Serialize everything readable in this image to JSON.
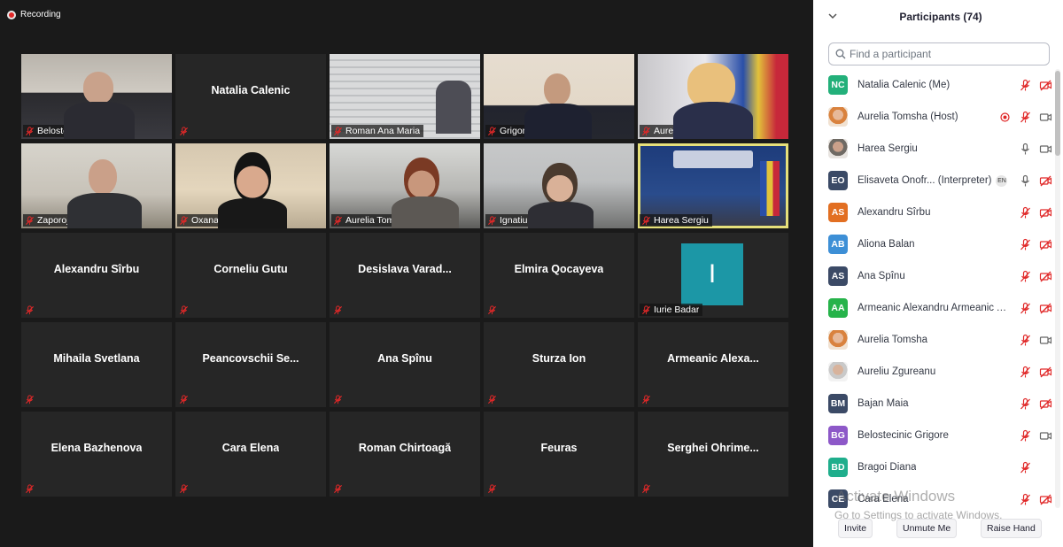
{
  "recording": {
    "label": "Recording"
  },
  "colors": {
    "panel_bg": "#ffffff",
    "muted_red": "#e02828",
    "active_speaker": "#e6e07a",
    "avatar_teal": "#1c97a6"
  },
  "tiles": [
    {
      "label": "Belostecinic Grig...",
      "video": "office"
    },
    {
      "center": "Natalia Calenic"
    },
    {
      "label": "Roman Ana Maria",
      "video": "blinds"
    },
    {
      "label": "Grigore Ioan Pir...",
      "video": "gallery"
    },
    {
      "label": "Aurelia Tomsha",
      "video": "flag"
    },
    {
      "label": "Zaporojan Veace...",
      "video": "man"
    },
    {
      "label": "Oxana Barbaneagra",
      "video": "woman"
    },
    {
      "label": "Aurelia Tomsha",
      "video": "room"
    },
    {
      "label": "Ignatiuc Diana",
      "video": "hall"
    },
    {
      "label": "Harea Sergiu",
      "video": "chamber",
      "active": true
    },
    {
      "center": "Alexandru Sîrbu"
    },
    {
      "center": "Corneliu Gutu"
    },
    {
      "center": "Desislava  Varad..."
    },
    {
      "center": "Elmira Qocayeva"
    },
    {
      "label": "Iurie Badar",
      "avatar_letter": "I"
    },
    {
      "center": "Mihaila Svetlana"
    },
    {
      "center": "Peancovschii  Se..."
    },
    {
      "center": "Ana Spînu"
    },
    {
      "center": "Sturza Ion"
    },
    {
      "center": "Armeanic  Alexa..."
    },
    {
      "center": "Elena Bazhenova"
    },
    {
      "center": "Cara Elena"
    },
    {
      "center": "Roman Chirtoagă"
    },
    {
      "center": "Feuras"
    },
    {
      "center": "Serghei  Ohrime..."
    }
  ],
  "panel": {
    "title": "Participants (74)",
    "search_placeholder": "Find a participant",
    "participants": [
      {
        "initials": "NC",
        "color": "#23b07a",
        "name": "Natalia Calenic (Me)",
        "mic": "muted",
        "video": "off"
      },
      {
        "initials": "",
        "photo": "photo",
        "name": "Aurelia Tomsha (Host)",
        "record": true,
        "mic": "muted",
        "video": "on"
      },
      {
        "initials": "",
        "photo": "photo2",
        "name": "Harea Sergiu",
        "mic": "on",
        "video": "on"
      },
      {
        "initials": "EO",
        "color": "#3b4a66",
        "name": "Elisaveta Onofr... (Interpreter)",
        "badge": "EN",
        "mic": "on",
        "video": "off"
      },
      {
        "initials": "AS",
        "color": "#e26f22",
        "name": "Alexandru Sîrbu",
        "mic": "muted",
        "video": "off"
      },
      {
        "initials": "AB",
        "color": "#3d8fd6",
        "name": "Aliona Balan",
        "mic": "muted",
        "video": "off"
      },
      {
        "initials": "AS",
        "color": "#3b4a66",
        "name": "Ana Spînu",
        "mic": "muted",
        "video": "off"
      },
      {
        "initials": "AA",
        "color": "#26b34a",
        "name": "Armeanic Alexandru Armeanic A...",
        "mic": "muted",
        "video": "off"
      },
      {
        "initials": "",
        "photo": "photo",
        "name": "Aurelia Tomsha",
        "mic": "muted",
        "video": "on"
      },
      {
        "initials": "",
        "photo": "photo3",
        "name": "Aureliu Zgureanu",
        "mic": "muted",
        "video": "off"
      },
      {
        "initials": "BM",
        "color": "#3b4a66",
        "name": "Bajan Maia",
        "mic": "muted",
        "video": "off"
      },
      {
        "initials": "BG",
        "color": "#8d58c8",
        "name": "Belostecinic Grigore",
        "mic": "muted",
        "video": "on"
      },
      {
        "initials": "BD",
        "color": "#1fae8c",
        "name": "Bragoi Diana",
        "mic": "muted",
        "video": "none"
      },
      {
        "initials": "CE",
        "color": "#3b4a66",
        "name": "Cara Elena",
        "mic": "muted",
        "video": "off"
      }
    ]
  },
  "watermark": {
    "title": "Activate Windows",
    "subtitle": "Go to Settings to activate Windows."
  },
  "footer": {
    "invite": "Invite",
    "unmute": "Unmute Me",
    "raise_hand": "Raise Hand"
  }
}
